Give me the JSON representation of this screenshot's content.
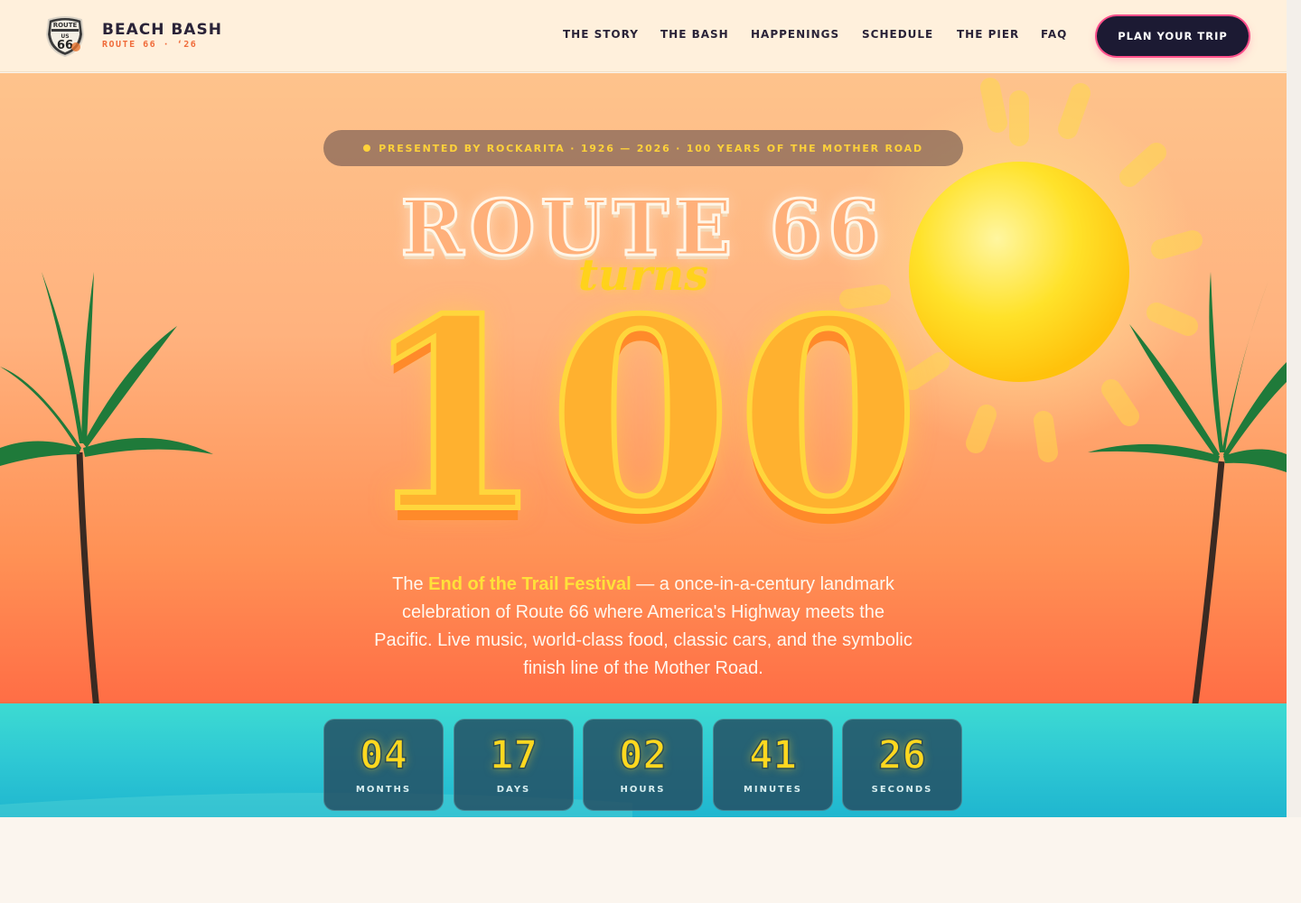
{
  "brand": {
    "name": "BEACH BASH",
    "sub": "ROUTE 66 · ‘26",
    "badge_top": "ROUTE",
    "badge_mid": "US",
    "badge_num": "66"
  },
  "nav": {
    "links": [
      "THE STORY",
      "THE BASH",
      "HAPPENINGS",
      "SCHEDULE",
      "THE PIER",
      "FAQ"
    ],
    "cta": "PLAN YOUR TRIP"
  },
  "hero": {
    "pill": "PRESENTED BY ROCKARITA · 1926 — 2026 · 100 YEARS OF THE MOTHER ROAD",
    "title_line1": "ROUTE 66",
    "title_line2": "turns",
    "title_big": "100",
    "desc_pre": "The ",
    "desc_highlight": "End of the Trail Festival",
    "desc_post": " — a once-in-a-century landmark celebration of Route 66 where America's Highway meets the Pacific. Live music, world-class food, classic cars, and the symbolic finish line of the Mother Road."
  },
  "countdown": [
    {
      "value": "04",
      "label": "MONTHS"
    },
    {
      "value": "17",
      "label": "DAYS"
    },
    {
      "value": "02",
      "label": "HOURS"
    },
    {
      "value": "41",
      "label": "MINUTES"
    },
    {
      "value": "26",
      "label": "SECONDS"
    }
  ],
  "colors": {
    "accent_yellow": "#ffd81f",
    "accent_orange": "#f06b3a",
    "navy": "#1c1a33",
    "cta_glow": "#ff4f8b",
    "sea": "#2ec8d4"
  },
  "icons": {
    "logo": "route-66-shield-icon",
    "sun": "sun-icon",
    "palm": "palm-tree-icon"
  }
}
